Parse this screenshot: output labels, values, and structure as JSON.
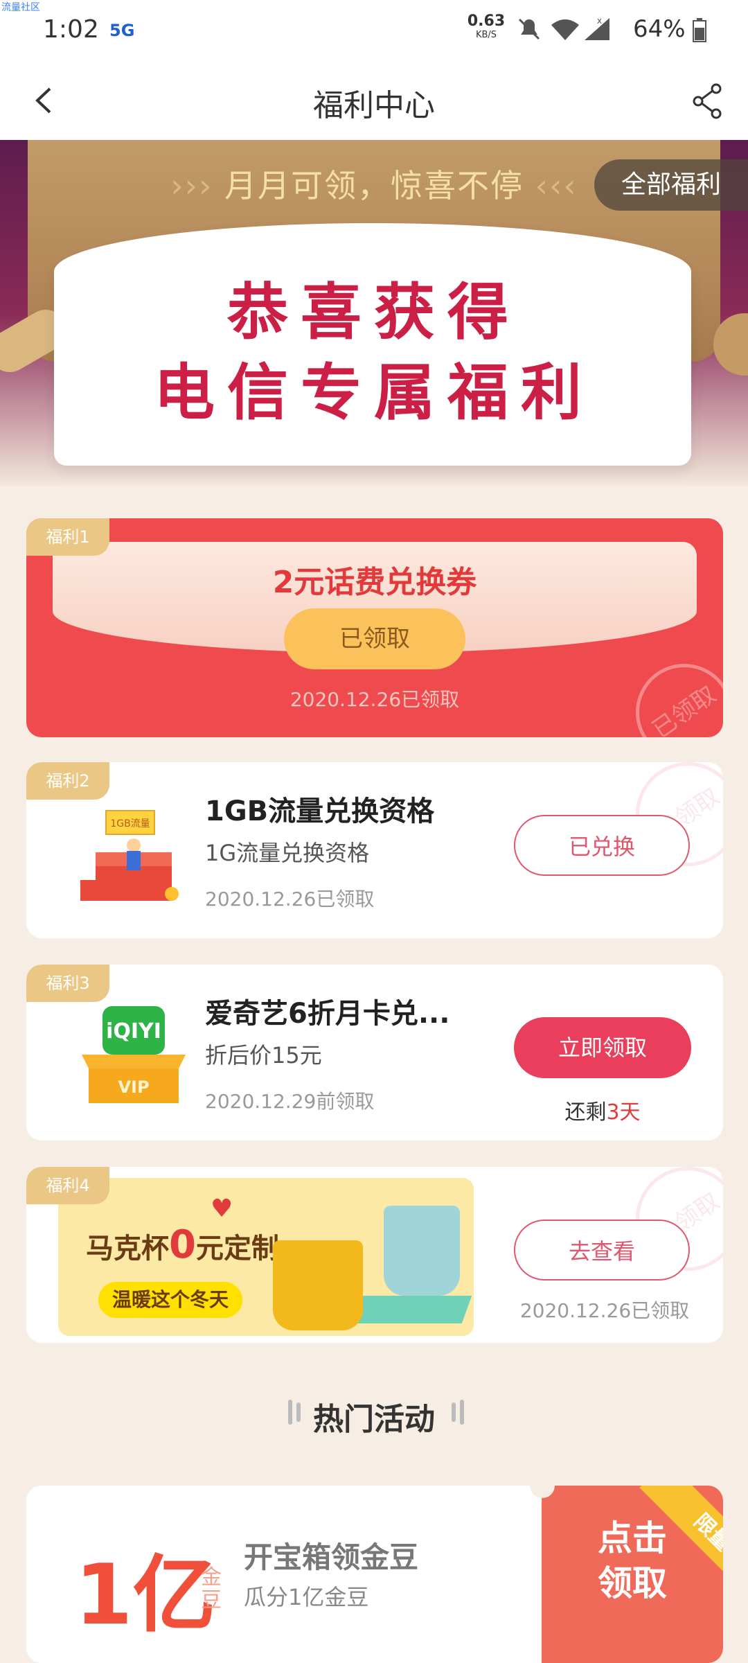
{
  "status_bar": {
    "brand_tiny": "流量社区",
    "time": "1:02",
    "network": "5G",
    "speed_value": "0.63",
    "speed_unit": "KB/S",
    "battery": "64%"
  },
  "nav": {
    "title": "福利中心"
  },
  "banner": {
    "subtitle": "月月可领，惊喜不停",
    "line1": "恭喜获得",
    "line2": "电信专属福利",
    "all_benefits": "全部福利"
  },
  "benefits": [
    {
      "tag": "福利1",
      "title": "2元话费兑换券",
      "button": "已领取",
      "date": "2020.12.26已领取",
      "stamp": "已领取"
    },
    {
      "tag": "福利2",
      "title": "1GB流量兑换资格",
      "subtitle": "1G流量兑换资格",
      "date": "2020.12.26已领取",
      "button": "已兑换",
      "image_label": "1GB流量",
      "stamp": "已领取"
    },
    {
      "tag": "福利3",
      "title": "爱奇艺6折月卡兑...",
      "subtitle": "折后价15元",
      "date": "2020.12.29前领取",
      "button": "立即领取",
      "remain_prefix": "还剩",
      "remain_value": "3天",
      "image_label": "VIP"
    },
    {
      "tag": "福利4",
      "banner_title_prefix": "马克杯",
      "banner_title_big": "0",
      "banner_title_suffix": "元定制",
      "banner_pill": "温暖这个冬天",
      "button": "去查看",
      "date": "2020.12.26已领取",
      "stamp": "已领取"
    }
  ],
  "hot": {
    "title": "热门活动",
    "activity": {
      "big": "1亿",
      "unit": "金豆",
      "title": "开宝箱领金豆",
      "subtitle": "瓜分1亿金豆",
      "cta": "点击领取",
      "ribbon": "限量"
    }
  },
  "colors": {
    "brand_red": "#ea3f5c",
    "gold": "#eac784",
    "page_bg": "#f6eee4"
  }
}
